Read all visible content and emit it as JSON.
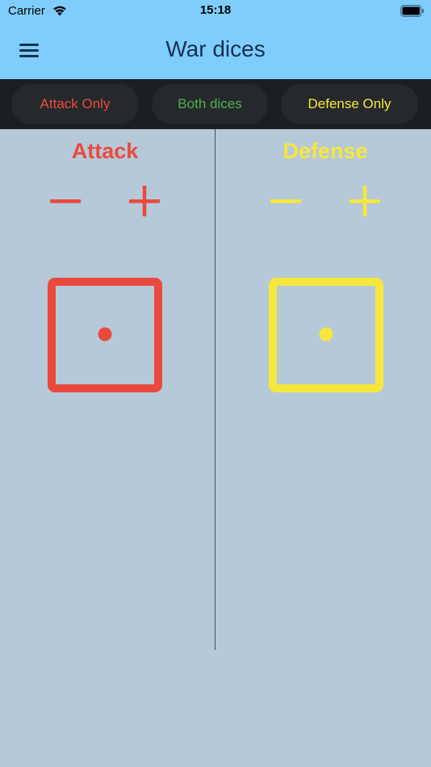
{
  "status_bar": {
    "carrier": "Carrier",
    "time": "15:18",
    "wifi_icon": "wifi-icon",
    "battery_icon": "battery-icon"
  },
  "nav": {
    "title": "War dices",
    "menu_icon": "hamburger-menu-icon"
  },
  "segments": {
    "attack_only": "Attack Only",
    "both_dices": "Both dices",
    "defense_only": "Defense Only"
  },
  "attack": {
    "title": "Attack",
    "minus_icon": "minus-icon",
    "plus_icon": "plus-icon",
    "dice_value": 1
  },
  "defense": {
    "title": "Defense",
    "minus_icon": "minus-icon",
    "plus_icon": "plus-icon",
    "dice_value": 1
  },
  "colors": {
    "nav_background": "#7fcdfd",
    "segment_bar": "#1c1f21",
    "content_background": "#b6c9d8",
    "attack": "#ea4a3d",
    "both": "#4caf50",
    "defense": "#f7e73c",
    "title_text": "#12324f"
  }
}
